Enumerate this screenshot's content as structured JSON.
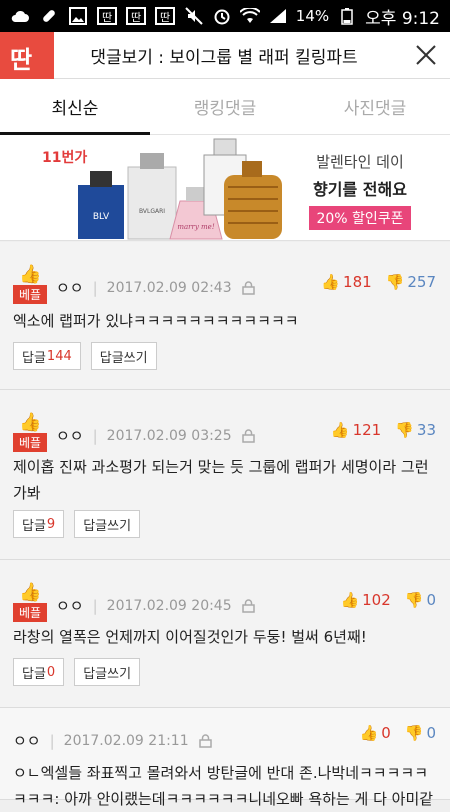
{
  "status_bar": {
    "battery_percent": "14%",
    "time": "오후 9:12",
    "left_icons": [
      "cloud-icon",
      "pill-icon",
      "image-icon",
      "app-icon",
      "app-icon",
      "app-icon"
    ],
    "right_icons": [
      "mute-icon",
      "alarm-icon",
      "wifi-icon",
      "signal-icon",
      "battery-icon"
    ]
  },
  "header": {
    "logo_text": "딴",
    "title": "댓글보기 : 보이그룹 별 래퍼 킬링파트",
    "close_label": "×"
  },
  "tabs": [
    {
      "label": "최신순",
      "active": true
    },
    {
      "label": "랭킹댓글",
      "active": false
    },
    {
      "label": "사진댓글",
      "active": false
    }
  ],
  "ad": {
    "brand": "11번가",
    "line1": "발렌타인 데이",
    "line2": "향기를 전해요",
    "coupon": "20% 할인쿠폰",
    "bottle_labels": [
      "BLV",
      "BVLGARI",
      "marry me!"
    ]
  },
  "comments": [
    {
      "best_badge": "베플",
      "nickname": "ㅇㅇ",
      "date": "2017.02.09 02:43",
      "up": "181",
      "down": "257",
      "text": "엑소에 랩퍼가 있냐ㅋㅋㅋㅋㅋㅋㅋㅋㅋㅋㅋㅋ",
      "reply_label": "답글",
      "reply_count": "144",
      "write_label": "답글쓰기"
    },
    {
      "best_badge": "베플",
      "nickname": "ㅇㅇ",
      "date": "2017.02.09 03:25",
      "up": "121",
      "down": "33",
      "text": "제이홉 진짜 과소평가 되는거 맞는 듯 그룹에 랩퍼가 세명이라 그런가봐",
      "reply_label": "답글",
      "reply_count": "9",
      "write_label": "답글쓰기"
    },
    {
      "best_badge": "베플",
      "nickname": "ㅇㅇ",
      "date": "2017.02.09 20:45",
      "up": "102",
      "down": "0",
      "text": "라창의 열폭은 언제까지 이어질것인가 두둥! 벌써 6년째!",
      "reply_label": "답글",
      "reply_count": "0",
      "write_label": "답글쓰기"
    },
    {
      "nickname": "ㅇㅇ",
      "date": "2017.02.09 21:11",
      "up": "0",
      "down": "0",
      "text": "ㅇㄴ엑셀들 좌표찍고 몰려와서 방탄글에 반대 존.나박네ㅋㅋㅋㅋㅋㅋㅋㅋ: 아까 안이랬는데ㅋㅋㅋㅋㅋㅋ니네오빠 욕하는 게 다 아미같"
    }
  ],
  "colors": {
    "accent": "#e0402f",
    "up_vote": "#d8362b",
    "down_vote": "#5a86c0",
    "coupon": "#e8457a"
  }
}
